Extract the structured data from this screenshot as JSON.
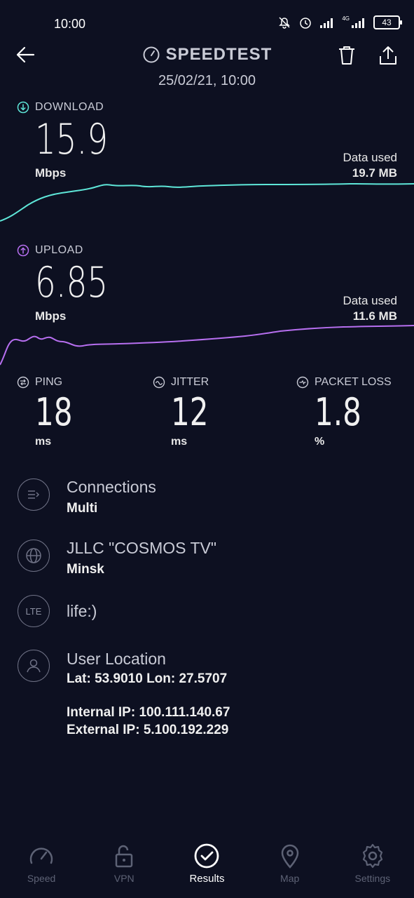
{
  "status_bar": {
    "time": "10:00",
    "battery": "43",
    "network": "4G"
  },
  "header": {
    "title": "SPEEDTEST",
    "date": "25/02/21, 10:00"
  },
  "download": {
    "label": "DOWNLOAD",
    "value": "15.9",
    "unit": "Mbps",
    "data_used_label": "Data used",
    "data_used": "19.7 MB",
    "color": "#5ee6d8"
  },
  "upload": {
    "label": "UPLOAD",
    "value": "6.85",
    "unit": "Mbps",
    "data_used_label": "Data used",
    "data_used": "11.6 MB",
    "color": "#b76ff0"
  },
  "ping": {
    "label": "PING",
    "value": "18",
    "unit": "ms"
  },
  "jitter": {
    "label": "JITTER",
    "value": "12",
    "unit": "ms"
  },
  "packet_loss": {
    "label": "PACKET LOSS",
    "value": "1.8",
    "unit": "%"
  },
  "connections": {
    "title": "Connections",
    "value": "Multi",
    "icon": "connections-icon"
  },
  "provider": {
    "title": "JLLC \"COSMOS TV\"",
    "value": "Minsk",
    "icon": "globe-icon"
  },
  "network": {
    "badge": "LTE",
    "title": "life:)"
  },
  "location": {
    "title": "User Location",
    "coords": "Lat: 53.9010 Lon: 27.5707",
    "internal_ip": "Internal IP: 100.111.140.67",
    "external_ip": "External IP: 5.100.192.229",
    "icon": "user-icon"
  },
  "nav": {
    "speed": "Speed",
    "vpn": "VPN",
    "results": "Results",
    "map": "Map",
    "settings": "Settings"
  }
}
